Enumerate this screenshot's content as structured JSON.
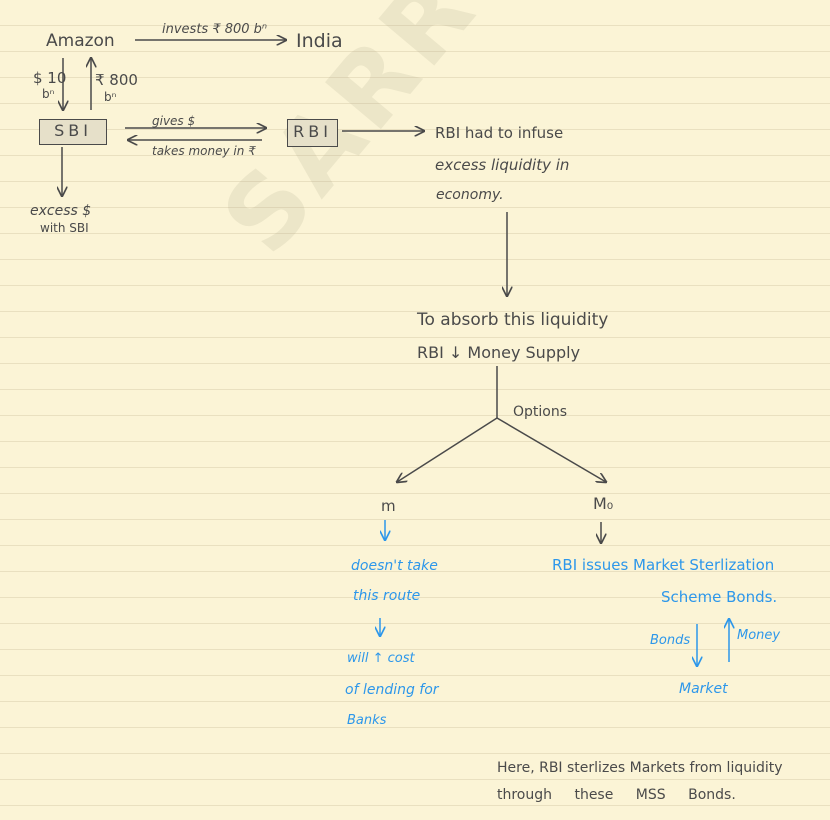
{
  "watermark": "SARRTHIAS",
  "nodes": {
    "amazon": "Amazon",
    "invests": "invests ₹ 800 bⁿ",
    "india": "India",
    "dollar_10": "$ 10",
    "bn_left": "bⁿ",
    "rupee_800": "₹ 800",
    "bn_right": "bⁿ",
    "sbi": "SBI",
    "gives": "gives $",
    "takes": "takes money in ₹",
    "rbi": "RBI",
    "rbi_infuse_1": "RBI had to infuse",
    "rbi_infuse_2": "excess liquidity in",
    "rbi_infuse_3": "economy.",
    "excess_1": "excess $",
    "excess_2": "with SBI",
    "absorb_1": "To absorb this liquidity",
    "absorb_2": "RBI ↓ Money Supply",
    "options": "Options",
    "m": "m",
    "m0": "M₀",
    "left_1": "doesn't take",
    "left_2": "this route",
    "left_3": "will ↑ cost",
    "left_4": "of lending for",
    "left_5": "Banks",
    "right_1": "RBI issues Market Sterlization",
    "right_2": "Scheme Bonds.",
    "bonds": "Bonds",
    "money": "Money",
    "market": "Market",
    "note_1": "Here, RBI sterlizes Markets from liquidity",
    "note_2": "through these MSS Bonds."
  },
  "colors": {
    "ink": "#4a4a4a",
    "blue": "#2d97ea",
    "paper": "#fbf4d6"
  }
}
